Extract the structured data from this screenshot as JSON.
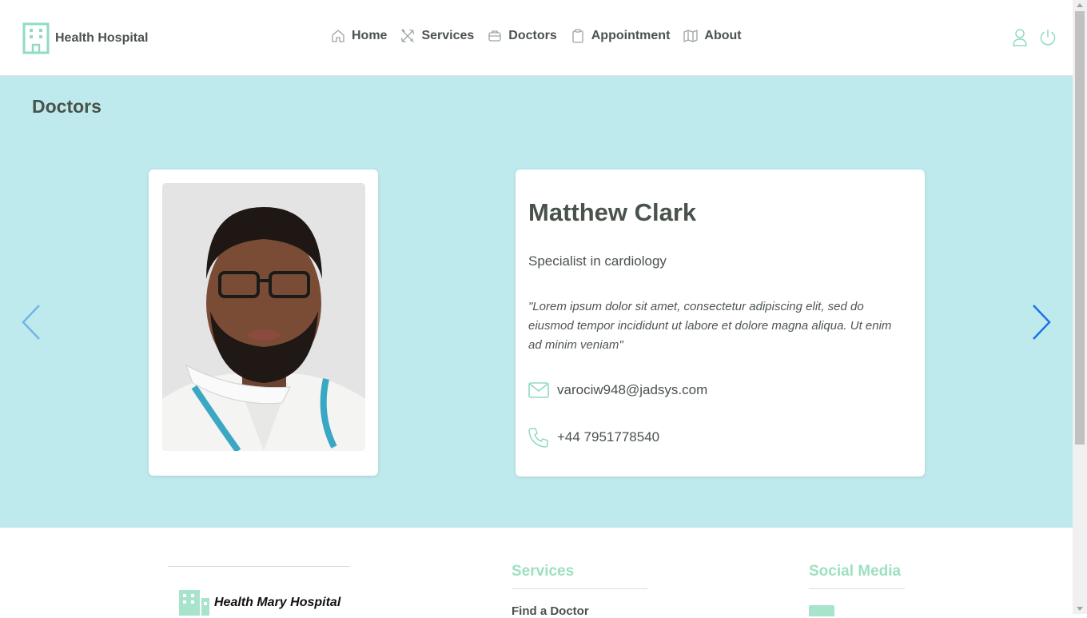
{
  "header": {
    "brand": "Health Hospital",
    "nav": [
      {
        "label": "Home",
        "icon": "home-icon"
      },
      {
        "label": "Services",
        "icon": "tools-icon"
      },
      {
        "label": "Doctors",
        "icon": "briefcase-icon"
      },
      {
        "label": "Appointment",
        "icon": "clipboard-icon"
      },
      {
        "label": "About",
        "icon": "map-icon"
      }
    ],
    "actions": [
      {
        "icon": "user-icon"
      },
      {
        "icon": "power-icon"
      }
    ]
  },
  "doctors_section": {
    "title": "Doctors",
    "doctor": {
      "name": "Matthew Clark",
      "specialty": "Specialist in cardiology",
      "quote": "\"Lorem ipsum dolor sit amet, consectetur adipiscing elit, sed do eiusmod tempor incididunt ut labore et dolore magna aliqua. Ut enim ad minim veniam\"",
      "email": "varociw948@jadsys.com",
      "phone": "+44 7951778540"
    },
    "prev_icon": "chevron-left-icon",
    "next_icon": "chevron-right-icon"
  },
  "footer": {
    "logo_text": "Health Mary Hospital",
    "services_title": "Services",
    "services_links": [
      "Find a Doctor"
    ],
    "social_title": "Social Media"
  },
  "colors": {
    "accent": "#9ee0c0",
    "section_bg": "#bfeaed",
    "arrow_prev": "#6fb6e8",
    "arrow_next": "#1a73e8",
    "text": "#4a524c"
  }
}
